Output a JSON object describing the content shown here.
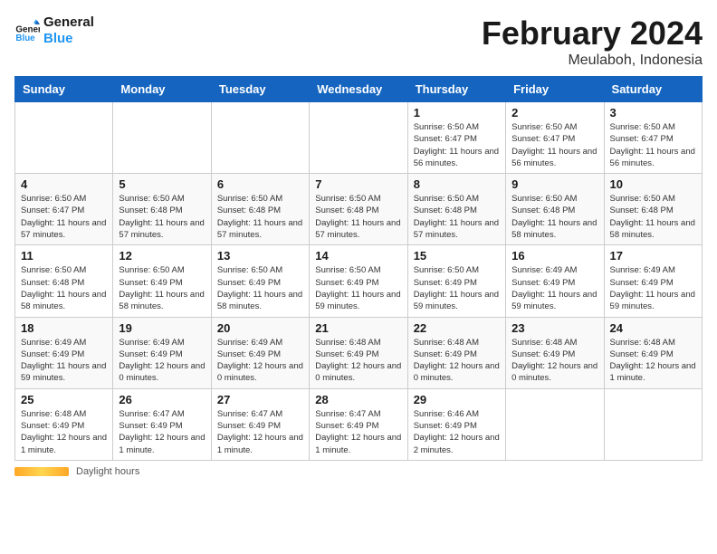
{
  "header": {
    "logo_general": "General",
    "logo_blue": "Blue",
    "title": "February 2024",
    "subtitle": "Meulaboh, Indonesia"
  },
  "columns": [
    "Sunday",
    "Monday",
    "Tuesday",
    "Wednesday",
    "Thursday",
    "Friday",
    "Saturday"
  ],
  "weeks": [
    [
      {
        "day": "",
        "info": ""
      },
      {
        "day": "",
        "info": ""
      },
      {
        "day": "",
        "info": ""
      },
      {
        "day": "",
        "info": ""
      },
      {
        "day": "1",
        "info": "Sunrise: 6:50 AM\nSunset: 6:47 PM\nDaylight: 11 hours and 56 minutes."
      },
      {
        "day": "2",
        "info": "Sunrise: 6:50 AM\nSunset: 6:47 PM\nDaylight: 11 hours and 56 minutes."
      },
      {
        "day": "3",
        "info": "Sunrise: 6:50 AM\nSunset: 6:47 PM\nDaylight: 11 hours and 56 minutes."
      }
    ],
    [
      {
        "day": "4",
        "info": "Sunrise: 6:50 AM\nSunset: 6:47 PM\nDaylight: 11 hours and 57 minutes."
      },
      {
        "day": "5",
        "info": "Sunrise: 6:50 AM\nSunset: 6:48 PM\nDaylight: 11 hours and 57 minutes."
      },
      {
        "day": "6",
        "info": "Sunrise: 6:50 AM\nSunset: 6:48 PM\nDaylight: 11 hours and 57 minutes."
      },
      {
        "day": "7",
        "info": "Sunrise: 6:50 AM\nSunset: 6:48 PM\nDaylight: 11 hours and 57 minutes."
      },
      {
        "day": "8",
        "info": "Sunrise: 6:50 AM\nSunset: 6:48 PM\nDaylight: 11 hours and 57 minutes."
      },
      {
        "day": "9",
        "info": "Sunrise: 6:50 AM\nSunset: 6:48 PM\nDaylight: 11 hours and 58 minutes."
      },
      {
        "day": "10",
        "info": "Sunrise: 6:50 AM\nSunset: 6:48 PM\nDaylight: 11 hours and 58 minutes."
      }
    ],
    [
      {
        "day": "11",
        "info": "Sunrise: 6:50 AM\nSunset: 6:48 PM\nDaylight: 11 hours and 58 minutes."
      },
      {
        "day": "12",
        "info": "Sunrise: 6:50 AM\nSunset: 6:49 PM\nDaylight: 11 hours and 58 minutes."
      },
      {
        "day": "13",
        "info": "Sunrise: 6:50 AM\nSunset: 6:49 PM\nDaylight: 11 hours and 58 minutes."
      },
      {
        "day": "14",
        "info": "Sunrise: 6:50 AM\nSunset: 6:49 PM\nDaylight: 11 hours and 59 minutes."
      },
      {
        "day": "15",
        "info": "Sunrise: 6:50 AM\nSunset: 6:49 PM\nDaylight: 11 hours and 59 minutes."
      },
      {
        "day": "16",
        "info": "Sunrise: 6:49 AM\nSunset: 6:49 PM\nDaylight: 11 hours and 59 minutes."
      },
      {
        "day": "17",
        "info": "Sunrise: 6:49 AM\nSunset: 6:49 PM\nDaylight: 11 hours and 59 minutes."
      }
    ],
    [
      {
        "day": "18",
        "info": "Sunrise: 6:49 AM\nSunset: 6:49 PM\nDaylight: 11 hours and 59 minutes."
      },
      {
        "day": "19",
        "info": "Sunrise: 6:49 AM\nSunset: 6:49 PM\nDaylight: 12 hours and 0 minutes."
      },
      {
        "day": "20",
        "info": "Sunrise: 6:49 AM\nSunset: 6:49 PM\nDaylight: 12 hours and 0 minutes."
      },
      {
        "day": "21",
        "info": "Sunrise: 6:48 AM\nSunset: 6:49 PM\nDaylight: 12 hours and 0 minutes."
      },
      {
        "day": "22",
        "info": "Sunrise: 6:48 AM\nSunset: 6:49 PM\nDaylight: 12 hours and 0 minutes."
      },
      {
        "day": "23",
        "info": "Sunrise: 6:48 AM\nSunset: 6:49 PM\nDaylight: 12 hours and 0 minutes."
      },
      {
        "day": "24",
        "info": "Sunrise: 6:48 AM\nSunset: 6:49 PM\nDaylight: 12 hours and 1 minute."
      }
    ],
    [
      {
        "day": "25",
        "info": "Sunrise: 6:48 AM\nSunset: 6:49 PM\nDaylight: 12 hours and 1 minute."
      },
      {
        "day": "26",
        "info": "Sunrise: 6:47 AM\nSunset: 6:49 PM\nDaylight: 12 hours and 1 minute."
      },
      {
        "day": "27",
        "info": "Sunrise: 6:47 AM\nSunset: 6:49 PM\nDaylight: 12 hours and 1 minute."
      },
      {
        "day": "28",
        "info": "Sunrise: 6:47 AM\nSunset: 6:49 PM\nDaylight: 12 hours and 1 minute."
      },
      {
        "day": "29",
        "info": "Sunrise: 6:46 AM\nSunset: 6:49 PM\nDaylight: 12 hours and 2 minutes."
      },
      {
        "day": "",
        "info": ""
      },
      {
        "day": "",
        "info": ""
      }
    ]
  ],
  "footer": {
    "daylight_label": "Daylight hours"
  }
}
